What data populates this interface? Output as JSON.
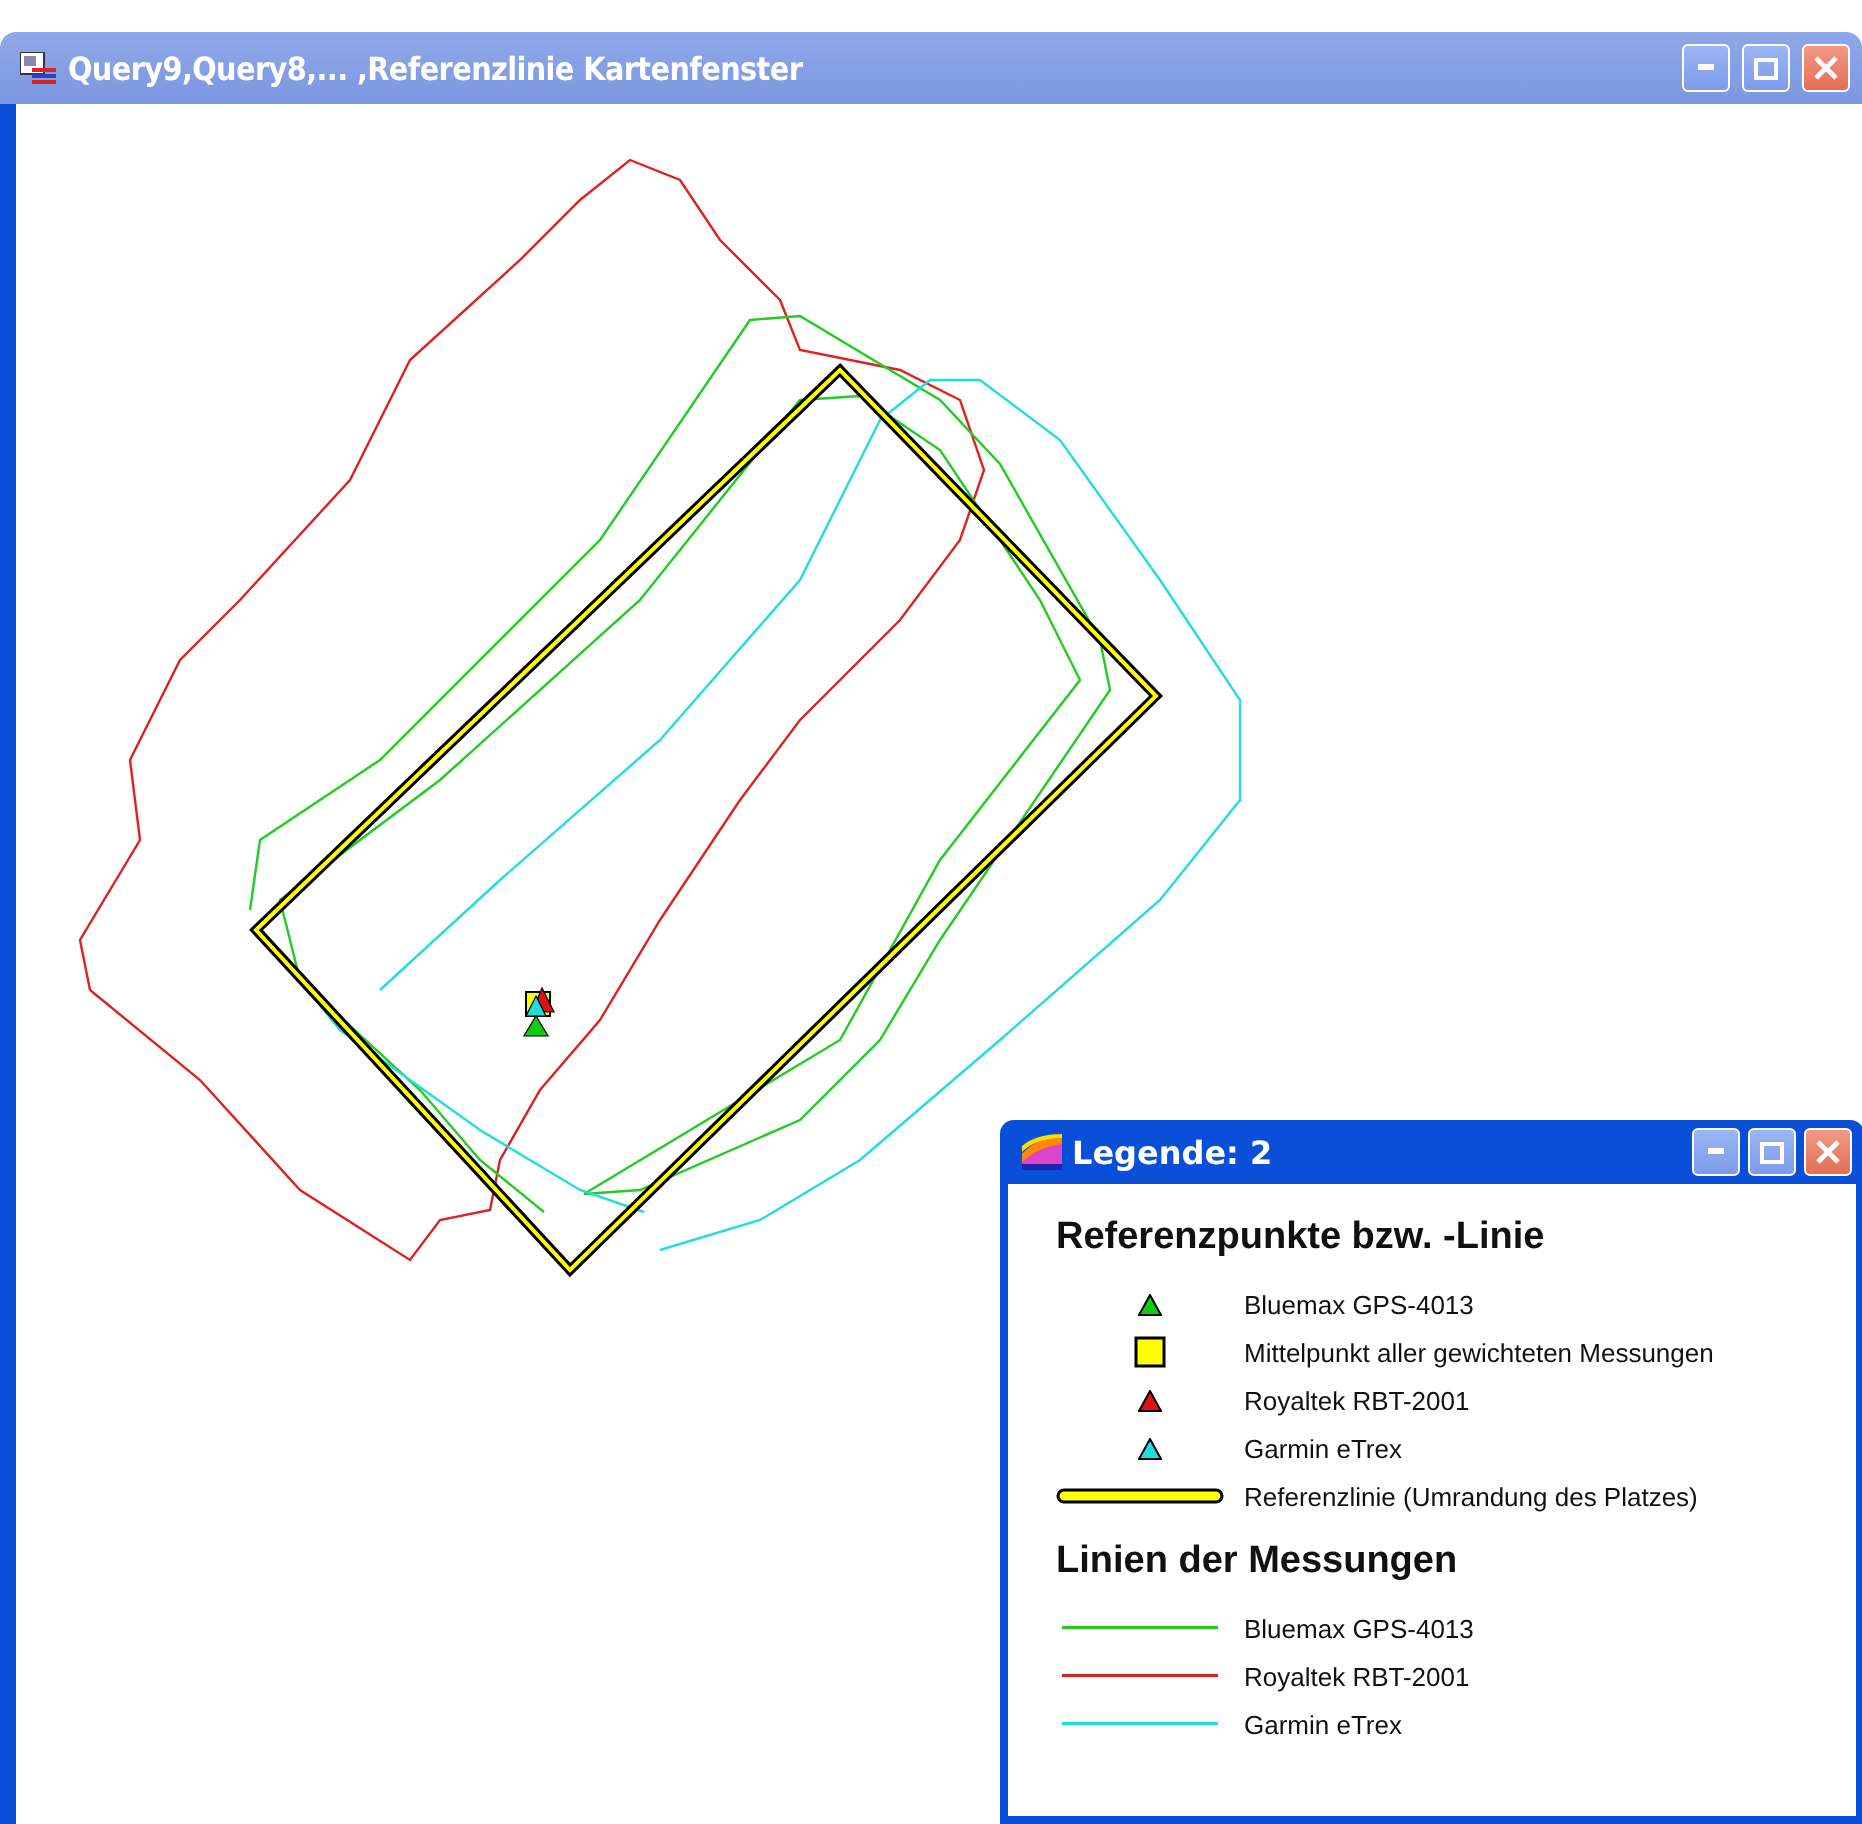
{
  "window": {
    "title": "Query9,Query8,... ,Referenzlinie Kartenfenster"
  },
  "legend": {
    "title": "Legende: 2",
    "sections": [
      {
        "heading": "Referenzpunkte bzw. -Linie",
        "items": [
          {
            "kind": "triangle",
            "color": "#11cc11",
            "label": "Bluemax GPS-4013"
          },
          {
            "kind": "square",
            "color": "#ffff00",
            "label": "Mittelpunkt aller gewichteten Messungen"
          },
          {
            "kind": "triangle",
            "color": "#dd1111",
            "label": "Royaltek RBT-2001"
          },
          {
            "kind": "triangle",
            "color": "#22dddd",
            "label": "Garmin eTrex"
          },
          {
            "kind": "thick-line",
            "color": "#ffff00",
            "label": "Referenzlinie (Umrandung des Platzes)"
          }
        ]
      },
      {
        "heading": "Linien der Messungen",
        "items": [
          {
            "kind": "line",
            "color": "#22cc22",
            "label": "Bluemax GPS-4013"
          },
          {
            "kind": "line",
            "color": "#dd2222",
            "label": "Royaltek RBT-2001"
          },
          {
            "kind": "line",
            "color": "#22dddd",
            "label": "Garmin eTrex"
          }
        ]
      }
    ]
  }
}
